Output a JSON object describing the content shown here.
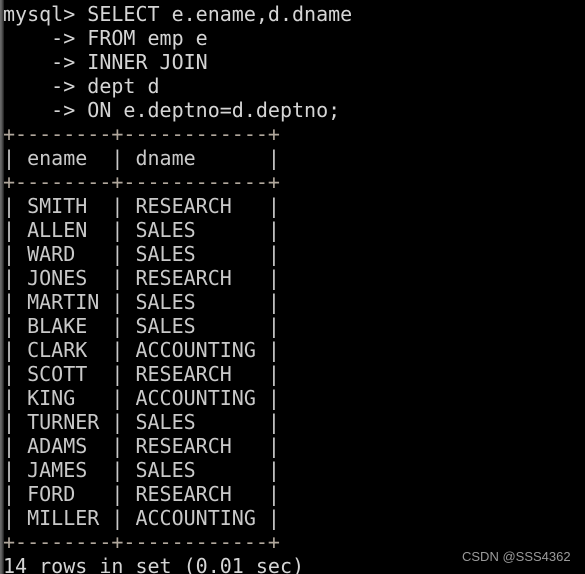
{
  "terminal": {
    "app": "mysql-client",
    "background_color": "#000000",
    "text_color": "#cfcfcf",
    "border_color": "#b0a79c",
    "prompt": "mysql>",
    "continuation_prompt": "->",
    "query_lines": [
      "mysql> SELECT e.ename,d.dname",
      "    -> FROM emp e",
      "    -> INNER JOIN",
      "    -> dept d",
      "    -> ON e.deptno=d.deptno;"
    ],
    "table": {
      "top_rule": "+--------+------------+",
      "header_rule": "+--------+------------+",
      "bottom_rule": "+--------+------------+",
      "columns": [
        "ename",
        "dname"
      ],
      "header_line": "| ename  | dname      |",
      "rows": [
        {
          "ename": "SMITH",
          "dname": "RESEARCH",
          "line": "| SMITH  | RESEARCH   |"
        },
        {
          "ename": "ALLEN",
          "dname": "SALES",
          "line": "| ALLEN  | SALES      |"
        },
        {
          "ename": "WARD",
          "dname": "SALES",
          "line": "| WARD   | SALES      |"
        },
        {
          "ename": "JONES",
          "dname": "RESEARCH",
          "line": "| JONES  | RESEARCH   |"
        },
        {
          "ename": "MARTIN",
          "dname": "SALES",
          "line": "| MARTIN | SALES      |"
        },
        {
          "ename": "BLAKE",
          "dname": "SALES",
          "line": "| BLAKE  | SALES      |"
        },
        {
          "ename": "CLARK",
          "dname": "ACCOUNTING",
          "line": "| CLARK  | ACCOUNTING |"
        },
        {
          "ename": "SCOTT",
          "dname": "RESEARCH",
          "line": "| SCOTT  | RESEARCH   |"
        },
        {
          "ename": "KING",
          "dname": "ACCOUNTING",
          "line": "| KING   | ACCOUNTING |"
        },
        {
          "ename": "TURNER",
          "dname": "SALES",
          "line": "| TURNER | SALES      |"
        },
        {
          "ename": "ADAMS",
          "dname": "RESEARCH",
          "line": "| ADAMS  | RESEARCH   |"
        },
        {
          "ename": "JAMES",
          "dname": "SALES",
          "line": "| JAMES  | SALES      |"
        },
        {
          "ename": "FORD",
          "dname": "RESEARCH",
          "line": "| FORD   | RESEARCH   |"
        },
        {
          "ename": "MILLER",
          "dname": "ACCOUNTING",
          "line": "| MILLER | ACCOUNTING |"
        }
      ]
    },
    "status_line": "14 rows in set (0.01 sec)",
    "row_count": 14,
    "elapsed": "0.01 sec"
  },
  "watermark": {
    "text": "CSDN @SSS4362"
  }
}
